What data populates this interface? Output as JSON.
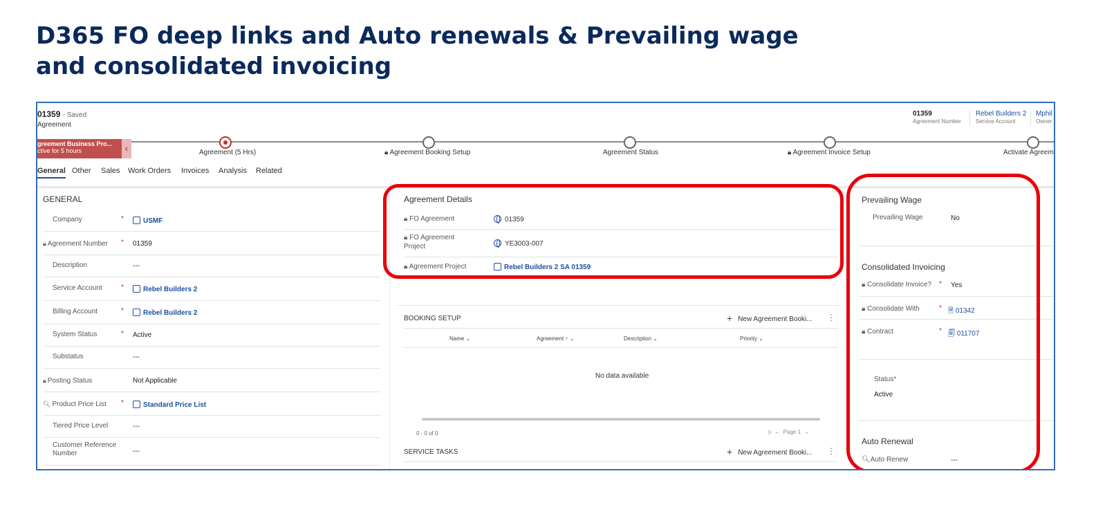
{
  "slide": {
    "title_line1": "D365 FO deep links and Auto renewals & Prevailing wage",
    "title_line2": "and consolidated invoicing"
  },
  "header": {
    "record_id": "01359",
    "saved": "- Saved",
    "record_type": "Agreement",
    "agreement_number": {
      "value": "01359",
      "label": "Agreement Number"
    },
    "service_account": {
      "value": "Rebel Builders 2",
      "label": "Service Account"
    },
    "owner": {
      "value": "Mphil",
      "label": "Owner"
    }
  },
  "bpf": {
    "active_name": "greement Business Pro...",
    "active_time": "ctive for 5 hours",
    "stages": [
      {
        "label": "Agreement  (5 Hrs)",
        "locked": false,
        "active": true
      },
      {
        "label": "Agreement Booking Setup",
        "locked": true,
        "active": false
      },
      {
        "label": "Agreement Status",
        "locked": false,
        "active": false
      },
      {
        "label": "Agreement Invoice Setup",
        "locked": true,
        "active": false
      },
      {
        "label": "Activate Agreeme",
        "locked": false,
        "active": false
      }
    ]
  },
  "tabs": [
    "General",
    "Other",
    "Sales",
    "Work Orders",
    "Invoices",
    "Analysis",
    "Related"
  ],
  "general": {
    "title": "GENERAL",
    "rows": [
      {
        "label": "Company",
        "value": "USMF"
      },
      {
        "label": "Agreement Number",
        "value": "01359"
      },
      {
        "label": "Description",
        "value": "---"
      },
      {
        "label": "Service Account",
        "value": "Rebel Builders 2"
      },
      {
        "label": "Billing Account",
        "value": "Rebel Builders 2"
      },
      {
        "label": "System Status",
        "value": "Active"
      },
      {
        "label": "Substatus",
        "value": "---"
      },
      {
        "label": "Posting Status",
        "value": "Not Applicable"
      },
      {
        "label": "Product Price List",
        "value": "Standard Price List"
      },
      {
        "label": "Tiered Price Level",
        "value": "---"
      },
      {
        "label": "Customer Reference Number",
        "value": "---"
      }
    ]
  },
  "agreement_details": {
    "title": "Agreement Details",
    "rows": [
      {
        "label": "FO Agreement",
        "value": "01359"
      },
      {
        "label": "FO Agreement Project",
        "value": "YE3003-007"
      },
      {
        "label": "Agreement Project",
        "value": "Rebel Builders 2 SA 01359"
      }
    ]
  },
  "booking_setup": {
    "title": "BOOKING SETUP",
    "command": "New Agreement Booki...",
    "columns": [
      "Name",
      "Agreement",
      "Description",
      "Priority"
    ],
    "empty_text": "No data available",
    "count": "0 - 0 of 0",
    "page": "Page 1"
  },
  "service_tasks": {
    "title": "SERVICE TASKS",
    "command": "New Agreement Booki..."
  },
  "prevailing_wage": {
    "title": "Prevailing Wage",
    "label": "Prevailing Wage",
    "value": "No"
  },
  "consolidated_invoicing": {
    "title": "Consolidated Invoicing",
    "rows": [
      {
        "label": "Consolidate Invoice?",
        "value": "Yes"
      },
      {
        "label": "Consolidate With",
        "value": "01342"
      },
      {
        "label": "Contract",
        "value": "011707"
      }
    ]
  },
  "status": {
    "label": "Status",
    "value": "Active"
  },
  "auto_renewal": {
    "title": "Auto Renewal",
    "label": "Auto Renew",
    "value": "---"
  },
  "colors": {
    "title": "#0b2a5b",
    "frame": "#2f6fb7",
    "annotation": "#e8000b",
    "bpf_active": "#c0504d",
    "link": "#1e4fa0"
  }
}
